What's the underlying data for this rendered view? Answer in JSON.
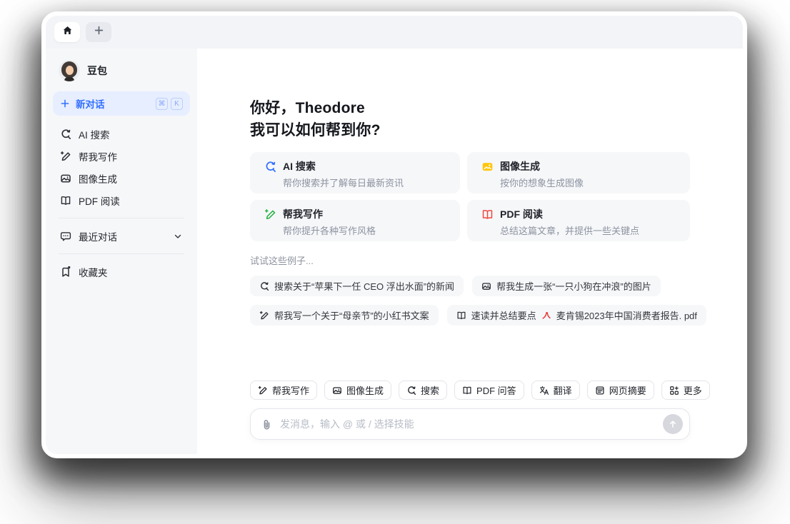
{
  "sidebar": {
    "profile_name": "豆包",
    "new_chat_label": "新对话",
    "shortcut": [
      "⌘",
      "K"
    ],
    "items": [
      {
        "label": "AI 搜索",
        "icon": "ai-search-icon"
      },
      {
        "label": "帮我写作",
        "icon": "write-icon"
      },
      {
        "label": "图像生成",
        "icon": "image-gen-icon"
      },
      {
        "label": "PDF 阅读",
        "icon": "book-icon"
      }
    ],
    "recent_label": "最近对话",
    "favorites_label": "收藏夹"
  },
  "main": {
    "greeting_line1": "你好，Theodore",
    "greeting_line2": "我可以如何帮到你?",
    "cards": [
      {
        "title": "AI 搜索",
        "subtitle": "帮你搜索并了解每日最新资讯",
        "icon": "ai-search-icon",
        "accent": "#3370ff"
      },
      {
        "title": "图像生成",
        "subtitle": "按你的想象生成图像",
        "icon": "image-gen-icon",
        "accent": "#ffc60a"
      },
      {
        "title": "帮我写作",
        "subtitle": "帮你提升各种写作风格",
        "icon": "write-icon",
        "accent": "#2cb34a"
      },
      {
        "title": "PDF 阅读",
        "subtitle": "总结这篇文章，并提供一些关键点",
        "icon": "book-icon",
        "accent": "#ef4840"
      }
    ],
    "examples_title": "试试这些例子...",
    "examples": [
      {
        "text": "搜索关于“苹果下一任 CEO 浮出水面”的新闻",
        "icon": "ai-search-icon"
      },
      {
        "text": "帮我生成一张“一只小狗在冲浪”的图片",
        "icon": "image-gen-icon"
      },
      {
        "text": "帮我写一个关于“母亲节”的小红书文案",
        "icon": "write-icon"
      },
      {
        "text": "速读并总结要点",
        "file_name": "麦肯锡2023年中国消费者报告. pdf",
        "icon": "book-icon",
        "file_icon": "pdf-file-icon"
      }
    ]
  },
  "composer": {
    "skills": [
      {
        "label": "帮我写作",
        "icon": "write-icon"
      },
      {
        "label": "图像生成",
        "icon": "image-gen-icon"
      },
      {
        "label": "搜索",
        "icon": "ai-search-icon"
      },
      {
        "label": "PDF 问答",
        "icon": "book-icon"
      },
      {
        "label": "翻译",
        "icon": "translate-icon"
      },
      {
        "label": "网页摘要",
        "icon": "webpage-icon"
      },
      {
        "label": "更多",
        "icon": "more-icon"
      }
    ],
    "placeholder": "发消息，输入 @ 或 / 选择技能"
  },
  "colors": {
    "accent_blue": "#3370ff",
    "new_chat_bg": "#e6eeff",
    "sidebar_bg": "#f6f7f9",
    "card_bg": "#f6f7f9",
    "green": "#2cb34a",
    "yellow": "#ffc60a",
    "red": "#ef4840",
    "pdf_red": "#e5322d"
  }
}
